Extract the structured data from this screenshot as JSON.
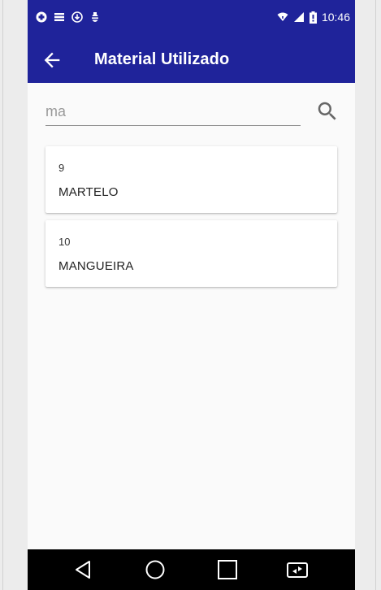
{
  "status_bar": {
    "time": "10:46",
    "left_icons": [
      "android-debug-icon",
      "storage-icon",
      "download-icon",
      "bug-icon"
    ],
    "right_icons": [
      "wifi-icon",
      "signal-icon",
      "battery-icon"
    ]
  },
  "app_bar": {
    "title": "Material Utilizado",
    "back_icon": "arrow-back-icon"
  },
  "search": {
    "value": "ma",
    "icon": "search-icon"
  },
  "items": [
    {
      "id": "9",
      "name": "MARTELO"
    },
    {
      "id": "10",
      "name": "MANGUEIRA"
    }
  ],
  "nav_bar": {
    "icons": [
      "nav-back-icon",
      "nav-home-icon",
      "nav-recents-icon",
      "rotate-screen-icon"
    ]
  },
  "colors": {
    "primary": "#1f239a",
    "background": "#fafafa",
    "navbar": "#000000"
  }
}
